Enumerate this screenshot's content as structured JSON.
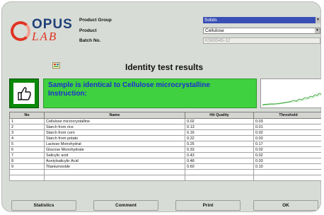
{
  "header": {
    "logo": {
      "word1": "OPUS",
      "word2": "LAB"
    },
    "product_group_label": "Product Group",
    "product_group_value": "Solids",
    "product_label": "Product",
    "product_value": "Cellulose",
    "batch_label": "Batch No.",
    "batch_value": "K560545-12"
  },
  "title": "Identity test results",
  "result": {
    "line1": "Sample is identical to Cellulose microcrystalline",
    "line2": "Instruction:"
  },
  "table": {
    "columns": [
      "No",
      "Name",
      "Hit Quality",
      "Threshold"
    ],
    "rows": [
      {
        "no": "1",
        "name": "Cellulose microcrystalline",
        "hit": "0.02",
        "threshold": "0.03"
      },
      {
        "no": "2",
        "name": "Starch from rice",
        "hit": "0.13",
        "threshold": "0.01"
      },
      {
        "no": "3",
        "name": "Starch from corn",
        "hit": "0.16",
        "threshold": "0.02"
      },
      {
        "no": "4",
        "name": "Starch from potato",
        "hit": "0.22",
        "threshold": "0.03"
      },
      {
        "no": "5",
        "name": "Lactose Monohydrat",
        "hit": "0.25",
        "threshold": "0.17"
      },
      {
        "no": "6",
        "name": "Glucose Monohydrate",
        "hit": "0.33",
        "threshold": "0.02"
      },
      {
        "no": "7",
        "name": "Salicylic acid",
        "hit": "0.43",
        "threshold": "0.02"
      },
      {
        "no": "8",
        "name": "Acetylsalicylic Acid",
        "hit": "0.48",
        "threshold": "0.03"
      },
      {
        "no": "9",
        "name": "Titaniumoxide",
        "hit": "0.60",
        "threshold": "0.10"
      }
    ]
  },
  "buttons": {
    "statistics": "Statistics",
    "comment": "Comment",
    "print": "Print",
    "ok": "OK"
  }
}
